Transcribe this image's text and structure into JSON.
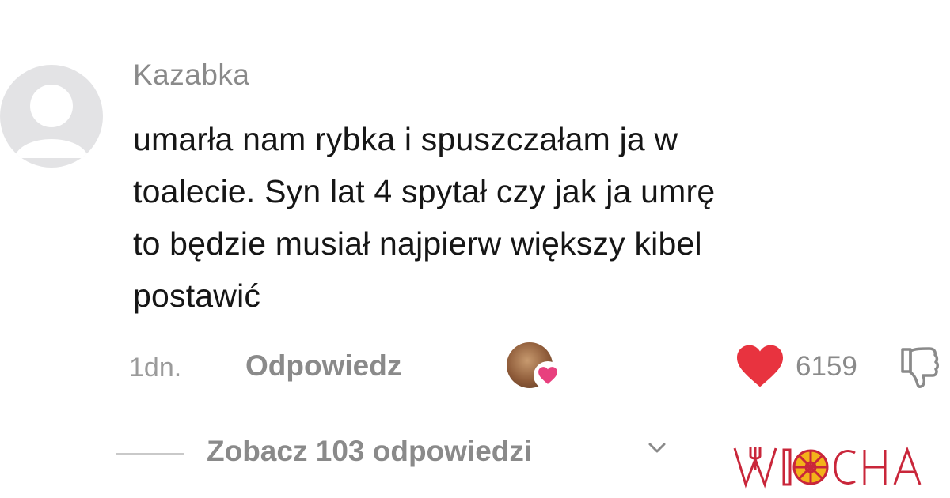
{
  "comment": {
    "username": "Kazabka",
    "text_lines": [
      "umarła nam rybka i spuszczałam ja w",
      "toalecie. Syn lat 4 spytał czy jak ja umrę",
      "to będzie musiał najpierw większy kibel",
      "postawić"
    ],
    "timestamp": "1dn.",
    "reply_label": "Odpowiedz",
    "like_count": "6159",
    "view_replies_label": "Zobacz 103 odpowiedzi"
  },
  "icons": {
    "avatar": "default-user-avatar-icon",
    "creator_liked": "creator-liked-heart-icon",
    "like": "heart-icon",
    "dislike": "thumbs-down-icon",
    "chevron": "chevron-down-icon"
  },
  "colors": {
    "like_heart": "#e8333f",
    "muted_text": "#8a8a8a",
    "body_text": "#161616"
  },
  "watermark": {
    "text": "WIOCHA",
    "color": "#c9263a"
  }
}
